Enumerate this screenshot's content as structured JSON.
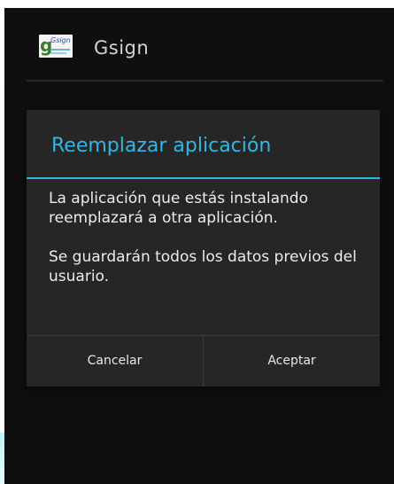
{
  "app": {
    "title": "Gsign",
    "icon": "gsign-app-icon",
    "icon_letter": "g",
    "icon_text": "Gsign"
  },
  "dialog": {
    "title": "Reemplazar aplicación",
    "message_1": "La aplicación que estás instalando reemplazará a otra aplicación.",
    "message_2": "Se guardarán todos los datos previos del usuario.",
    "cancel_label": "Cancelar",
    "accept_label": "Aceptar"
  },
  "colors": {
    "accent": "#33b5e5",
    "dialog_background": "#262626",
    "screen_background": "#0e0e0e"
  }
}
